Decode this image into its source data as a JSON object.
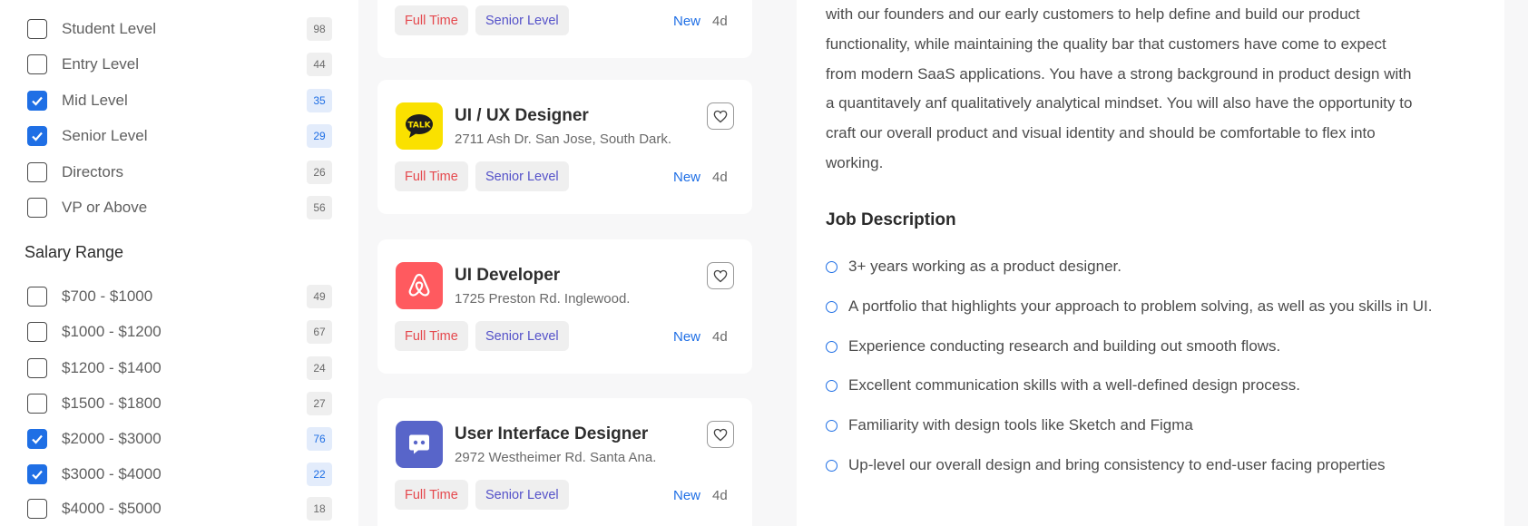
{
  "filters": {
    "experience": [
      {
        "label": "Student Level",
        "count": "98",
        "checked": false
      },
      {
        "label": "Entry Level",
        "count": "44",
        "checked": false
      },
      {
        "label": "Mid Level",
        "count": "35",
        "checked": true
      },
      {
        "label": "Senior Level",
        "count": "29",
        "checked": true
      },
      {
        "label": "Directors",
        "count": "26",
        "checked": false
      },
      {
        "label": "VP or Above",
        "count": "56",
        "checked": false
      }
    ],
    "salary_title": "Salary Range",
    "salary": [
      {
        "label": "$700 - $1000",
        "count": "49",
        "checked": false
      },
      {
        "label": "$1000 - $1200",
        "count": "67",
        "checked": false
      },
      {
        "label": "$1200 - $1400",
        "count": "24",
        "checked": false
      },
      {
        "label": "$1500 - $1800",
        "count": "27",
        "checked": false
      },
      {
        "label": "$2000 - $3000",
        "count": "76",
        "checked": true
      },
      {
        "label": "$3000 - $4000",
        "count": "22",
        "checked": true
      },
      {
        "label": "$4000 - $5000",
        "count": "18",
        "checked": false
      }
    ]
  },
  "jobs": [
    {
      "title": "",
      "address": "",
      "type": "Full Time",
      "level": "Senior Level",
      "status": "New",
      "age": "4d"
    },
    {
      "title": "UI / UX Designer",
      "address": "2711 Ash Dr. San Jose, South Dark.",
      "type": "Full Time",
      "level": "Senior Level",
      "status": "New",
      "age": "4d",
      "logo_text": "TALK",
      "logo_color": "#fae100"
    },
    {
      "title": "UI Developer",
      "address": "1725 Preston Rd. Inglewood.",
      "type": "Full Time",
      "level": "Senior Level",
      "status": "New",
      "age": "4d",
      "logo_color": "#ff5a5f"
    },
    {
      "title": "User Interface Designer",
      "address": "2972 Westheimer Rd. Santa Ana.",
      "type": "Full Time",
      "level": "Senior Level",
      "status": "New",
      "age": "4d",
      "logo_color": "#5865c9"
    }
  ],
  "detail": {
    "paragraph_lines": [
      "with our founders and our early customers to help define and build our product",
      "functionality, while maintaining the quality bar that customers have come to expect",
      "from modern SaaS applications. You have a strong background in product design with",
      "a quantitavely anf qualitatively analytical mindset. You will also have the opportunity to",
      "craft our overall product and visual identity and should be comfortable to flex into",
      "working."
    ],
    "description_title": "Job Description",
    "bullets": [
      "3+ years working as a product designer.",
      "A portfolio that highlights your approach to problem solving, as well as you skills in UI.",
      "Experience conducting research and building out smooth flows.",
      "Excellent communication skills with a well-defined design process.",
      "Familiarity with design tools like Sketch and Figma",
      "Up-level our overall design and bring consistency to end-user facing properties"
    ]
  },
  "colors": {
    "accent": "#1f6fe5",
    "full_time": "#e5484d",
    "senior_level": "#5451c9"
  }
}
